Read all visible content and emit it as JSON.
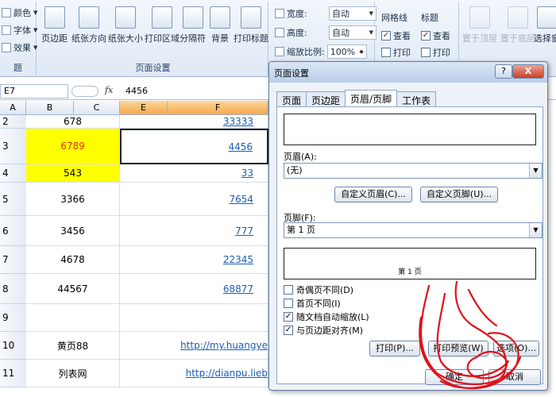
{
  "ribbon": {
    "theme_group": {
      "label": "题",
      "colors": "颜色",
      "fonts": "字体",
      "effects": "效果"
    },
    "page_setup_group": {
      "label": "页面设置",
      "buttons": [
        "页边距",
        "纸张方向",
        "纸张大小",
        "打印区域",
        "分隔符",
        "背景",
        "打印标题"
      ]
    },
    "scale_group": {
      "width_label": "宽度:",
      "width_value": "自动",
      "height_label": "高度:",
      "height_value": "自动",
      "scale_label": "缩放比例:",
      "scale_value": "100%"
    },
    "sheet_options": {
      "gridlines_label": "网格线",
      "headings_label": "标题",
      "view_label": "查看",
      "print_label": "打印"
    },
    "arrange_group": {
      "bring_forward": "置于顶层",
      "send_backward": "置于底层",
      "selection_pane": "选择窗"
    }
  },
  "formula_bar": {
    "name_box": "E7",
    "fx": "fx",
    "value": "4456"
  },
  "columns": {
    "row_header": "A",
    "b": "B",
    "c": "C",
    "e": "E",
    "f": "F"
  },
  "rows": [
    {
      "num": "2",
      "b": "678",
      "link": "33333"
    },
    {
      "num": "3",
      "b": "6789",
      "link": "4456"
    },
    {
      "num": "4",
      "b": "543",
      "link": "33"
    },
    {
      "num": "5",
      "b": "3366",
      "link": "7654"
    },
    {
      "num": "6",
      "b": "3456",
      "link": "777"
    },
    {
      "num": "7",
      "b": "4678",
      "link": "22345"
    },
    {
      "num": "8",
      "b": "44567",
      "link": "68877"
    },
    {
      "num": "9",
      "b": "",
      "link": ""
    },
    {
      "num": "10",
      "b": "黄页88",
      "link": "http://my.huangye"
    },
    {
      "num": "11",
      "b": "列表网",
      "link": "http://dianpu.lieb"
    }
  ],
  "dialog": {
    "title": "页面设置",
    "help": "?",
    "close": "X",
    "tabs": [
      "页面",
      "页边距",
      "页眉/页脚",
      "工作表"
    ],
    "header_label": "页眉(A):",
    "header_value": "(无)",
    "custom_header": "自定义页眉(C)...",
    "custom_footer": "自定义页脚(U)...",
    "footer_label": "页脚(F):",
    "footer_value": "第 1 页",
    "footer_preview": "第 1 页",
    "options": [
      {
        "label": "奇偶页不同(D)",
        "checked": false
      },
      {
        "label": "首页不同(I)",
        "checked": false
      },
      {
        "label": "随文档自动缩放(L)",
        "checked": true
      },
      {
        "label": "与页边距对齐(M)",
        "checked": true
      }
    ],
    "print_button": "打印(P)...",
    "preview_button": "打印预览(W)",
    "options_button": "选项(O)...",
    "ok_button": "确定",
    "cancel_button": "取消"
  },
  "colors": {
    "highlight_yellow": "#ffff00",
    "red_text": "#e03020",
    "link_blue": "#1a5fb4",
    "scribble_red": "#e0101a"
  }
}
